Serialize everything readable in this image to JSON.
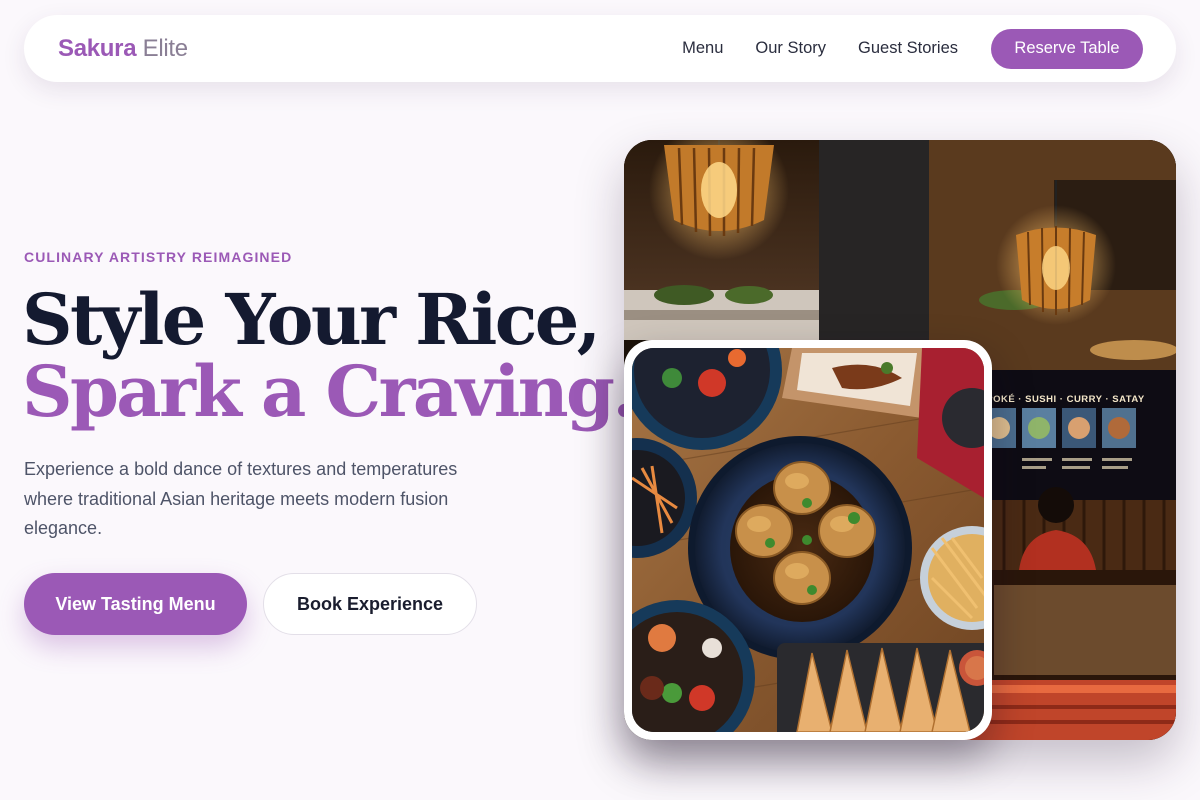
{
  "nav": {
    "brand_bold": "Sakura",
    "brand_light": " Elite",
    "links": [
      "Menu",
      "Our Story",
      "Guest Stories"
    ],
    "cta_label": "Reserve Table"
  },
  "hero": {
    "eyebrow": "CULINARY ARTISTRY REIMAGINED",
    "headline_line1": "Style Your Rice,",
    "headline_line2": "Spark a Craving.",
    "lead": "Experience a bold dance of textures and temperatures where traditional Asian heritage meets modern fusion elegance.",
    "primary_cta": "View Tasting Menu",
    "secondary_cta": "Book Experience"
  },
  "images": {
    "back_photo": "restaurant-interior-photo",
    "front_photo": "asian-fusion-dishes-photo",
    "menu_board_text": "KIMBAP · POKÉ · SUSHI · CURRY · SATAY"
  },
  "colors": {
    "accent": "#9b59b6",
    "heading": "#141a30",
    "background": "#fbf8fc"
  }
}
